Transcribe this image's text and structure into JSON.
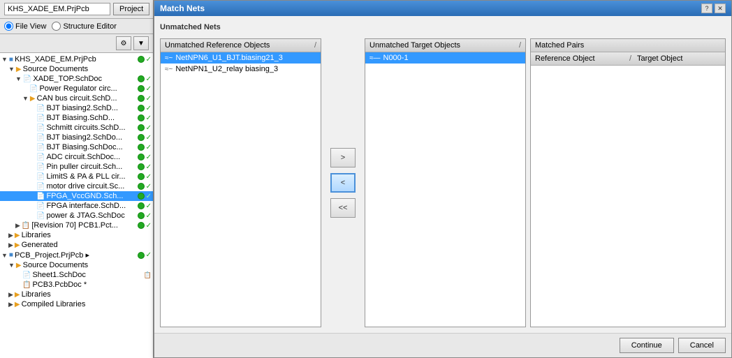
{
  "leftPanel": {
    "projectInput": "KHS_XADE_EM.PrjPcb",
    "projectBtn": "Project",
    "radioOptions": [
      {
        "id": "fileview",
        "label": "File View",
        "checked": true
      },
      {
        "id": "structeditor",
        "label": "Structure Editor",
        "checked": false
      }
    ],
    "tree": [
      {
        "id": "khs-root",
        "indent": 0,
        "expand": true,
        "icon": "📋",
        "label": "KHS_XADE_EM.PrjPcb",
        "hasStatus": true,
        "status": "green",
        "hasMark": true
      },
      {
        "id": "src-docs-1",
        "indent": 1,
        "expand": true,
        "icon": "📁",
        "label": "Source Documents",
        "hasStatus": false
      },
      {
        "id": "xade-top",
        "indent": 2,
        "expand": true,
        "icon": "📁",
        "label": "XADE_TOP.SchDoc",
        "hasStatus": true,
        "status": "green",
        "hasMark": true
      },
      {
        "id": "power-reg",
        "indent": 3,
        "expand": false,
        "icon": "📄",
        "label": "Power Regulator circ...",
        "hasStatus": true,
        "status": "green",
        "hasMark": true
      },
      {
        "id": "can-bus",
        "indent": 3,
        "expand": true,
        "icon": "📁",
        "label": "CAN bus circuit.SchD...",
        "hasStatus": true,
        "status": "green",
        "hasMark": true
      },
      {
        "id": "bjt-biasing2",
        "indent": 4,
        "expand": false,
        "icon": "📄",
        "label": "BJT biasing2.SchD...",
        "hasStatus": true,
        "status": "green",
        "hasMark": true
      },
      {
        "id": "bjt-biasing",
        "indent": 4,
        "expand": false,
        "icon": "📄",
        "label": "BJT Biasing.SchD...",
        "hasStatus": true,
        "status": "green",
        "hasMark": true
      },
      {
        "id": "schmitt",
        "indent": 4,
        "expand": false,
        "icon": "📄",
        "label": "Schmitt circuits.SchD...",
        "hasStatus": true,
        "status": "green",
        "hasMark": true
      },
      {
        "id": "bjt-biasing2b",
        "indent": 4,
        "expand": false,
        "icon": "📄",
        "label": "BJT biasing2.SchDo...",
        "hasStatus": true,
        "status": "green",
        "hasMark": true
      },
      {
        "id": "bjt-biasing-b",
        "indent": 4,
        "expand": false,
        "icon": "📄",
        "label": "BJT Biasing.SchDoc...",
        "hasStatus": true,
        "status": "green",
        "hasMark": true
      },
      {
        "id": "adc-circuit",
        "indent": 4,
        "expand": false,
        "icon": "📄",
        "label": "ADC circuit.SchDoc...",
        "hasStatus": true,
        "status": "green",
        "hasMark": true
      },
      {
        "id": "pin-puller",
        "indent": 4,
        "expand": false,
        "icon": "📄",
        "label": "Pin puller circuit.Sch...",
        "hasStatus": true,
        "status": "green",
        "hasMark": true
      },
      {
        "id": "limits-pa",
        "indent": 4,
        "expand": false,
        "icon": "📄",
        "label": "LimitS & PA & PLL cir...",
        "hasStatus": true,
        "status": "green",
        "hasMark": true
      },
      {
        "id": "motor-drive",
        "indent": 4,
        "expand": false,
        "icon": "📄",
        "label": "motor drive circuit.Sc...",
        "hasStatus": true,
        "status": "green",
        "hasMark": true
      },
      {
        "id": "fpga-vcc",
        "indent": 4,
        "expand": false,
        "icon": "📄",
        "label": "FPGA_VccGND.Sch...",
        "hasStatus": true,
        "status": "green",
        "hasMark": true,
        "selected": true
      },
      {
        "id": "fpga-interface",
        "indent": 4,
        "expand": false,
        "icon": "📄",
        "label": "FPGA interface.SchD...",
        "hasStatus": true,
        "status": "green",
        "hasMark": true
      },
      {
        "id": "power-jtag",
        "indent": 4,
        "expand": false,
        "icon": "📄",
        "label": "power & JTAG.SchDoc",
        "hasStatus": true,
        "status": "green",
        "hasMark": true
      },
      {
        "id": "revision70",
        "indent": 2,
        "expand": false,
        "icon": "📋",
        "label": "[Revision 70] PCB1.Pct...",
        "hasStatus": true,
        "status": "green",
        "hasMark": true
      },
      {
        "id": "libraries-1",
        "indent": 1,
        "expand": false,
        "icon": "📁",
        "label": "Libraries",
        "hasStatus": false
      },
      {
        "id": "generated-1",
        "indent": 1,
        "expand": false,
        "icon": "📁",
        "label": "Generated",
        "hasStatus": false
      },
      {
        "id": "pcb-root",
        "indent": 0,
        "expand": true,
        "icon": "📋",
        "label": "PCB_Project.PrjPcb ▸",
        "hasStatus": true,
        "status": "green",
        "hasMark": true
      },
      {
        "id": "src-docs-2",
        "indent": 1,
        "expand": true,
        "icon": "📁",
        "label": "Source Documents",
        "hasStatus": false
      },
      {
        "id": "sheet1",
        "indent": 2,
        "expand": false,
        "icon": "📄",
        "label": "Sheet1.SchDoc",
        "hasStatus": false
      },
      {
        "id": "pcb3",
        "indent": 2,
        "expand": false,
        "icon": "📋",
        "label": "PCB3.PcbDoc *",
        "hasStatus": false
      },
      {
        "id": "libraries-2",
        "indent": 1,
        "expand": false,
        "icon": "📁",
        "label": "Libraries",
        "hasStatus": false
      },
      {
        "id": "compiled-libs",
        "indent": 1,
        "expand": false,
        "icon": "📁",
        "label": "Compiled Libraries",
        "hasStatus": false
      }
    ]
  },
  "dialog": {
    "title": "Match Nets",
    "unmatchedNetsLabel": "Unmatched Nets",
    "matchedPairsLabel": "Matched Pairs",
    "refObjectsHeader": "Unmatched Reference Objects",
    "targetObjectsHeader": "Unmatched Target Objects",
    "sortIndicator": "/",
    "refObjectColHeader": "Reference Object",
    "targetObjectColHeader": "Target Object",
    "refItems": [
      {
        "id": "net-npn6",
        "label": "NetNPN6_U1_BJT.biasing21_3",
        "selected": true
      },
      {
        "id": "net-npn1",
        "label": "NetNPN1_U2_relay biasing_3",
        "selected": false
      }
    ],
    "targetItems": [
      {
        "id": "n000-1",
        "label": "N000-1",
        "selected": true
      }
    ],
    "arrows": {
      "right": ">",
      "left": "<",
      "leftLeft": "<<"
    },
    "buttons": {
      "continue": "Continue",
      "cancel": "Cancel"
    }
  }
}
